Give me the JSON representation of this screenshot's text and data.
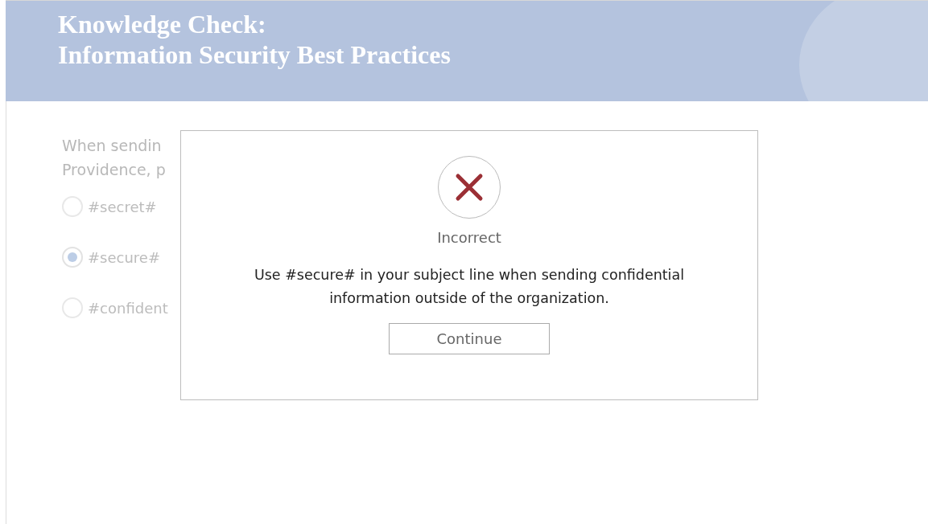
{
  "header": {
    "title_lines": [
      "Knowledge Check:",
      "Information Security Best Practices"
    ]
  },
  "question": {
    "lines": [
      "When sendin",
      "Providence, p"
    ]
  },
  "options": [
    {
      "label": "#secret#",
      "selected": false
    },
    {
      "label": "#secure#",
      "selected": true
    },
    {
      "label": "#confident",
      "selected": false
    }
  ],
  "dialog": {
    "result": "Incorrect",
    "message": "Use #secure# in your subject line when sending confidential information outside of the organization.",
    "button": "Continue"
  }
}
